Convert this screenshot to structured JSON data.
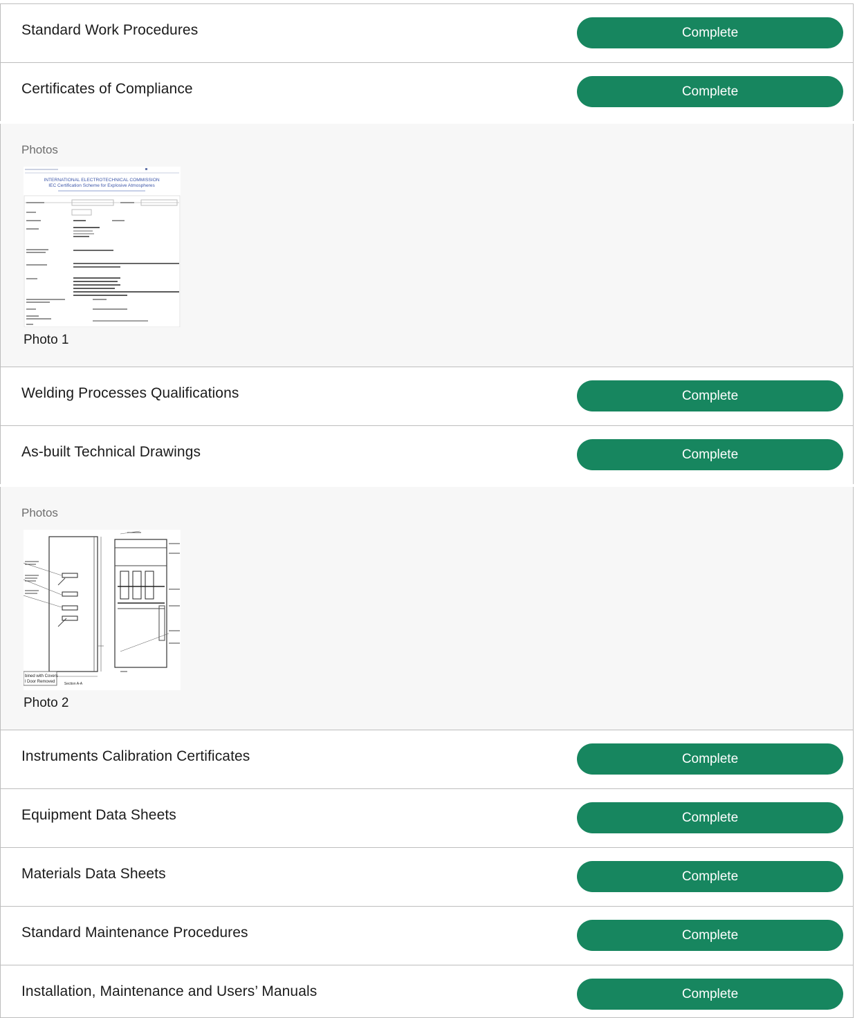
{
  "items": [
    {
      "title": "Standard Work Procedures",
      "status": "Complete"
    },
    {
      "title": "Certificates of Compliance",
      "status": "Complete"
    },
    {
      "title": "Welding Processes Qualifications",
      "status": "Complete"
    },
    {
      "title": "As-built Technical Drawings",
      "status": "Complete"
    },
    {
      "title": "Instruments Calibration Certificates",
      "status": "Complete"
    },
    {
      "title": "Equipment Data Sheets",
      "status": "Complete"
    },
    {
      "title": "Materials Data Sheets",
      "status": "Complete"
    },
    {
      "title": "Standard Maintenance Procedures",
      "status": "Complete"
    },
    {
      "title": "Installation, Maintenance and Users’ Manuals",
      "status": "Complete"
    }
  ],
  "photo_sections": [
    {
      "label": "Photos",
      "photo": {
        "caption": "Photo 1",
        "heading_line1": "INTERNATIONAL ELECTROTECHNICAL COMMISSION",
        "heading_line2": "IEC Certification Scheme for Explosive Atmospheres"
      }
    },
    {
      "label": "Photos",
      "photo": {
        "caption": "Photo 2",
        "note_line1": "bined with Covers",
        "note_line2": "l Door Removed",
        "section_label": "Section A-A"
      }
    }
  ]
}
